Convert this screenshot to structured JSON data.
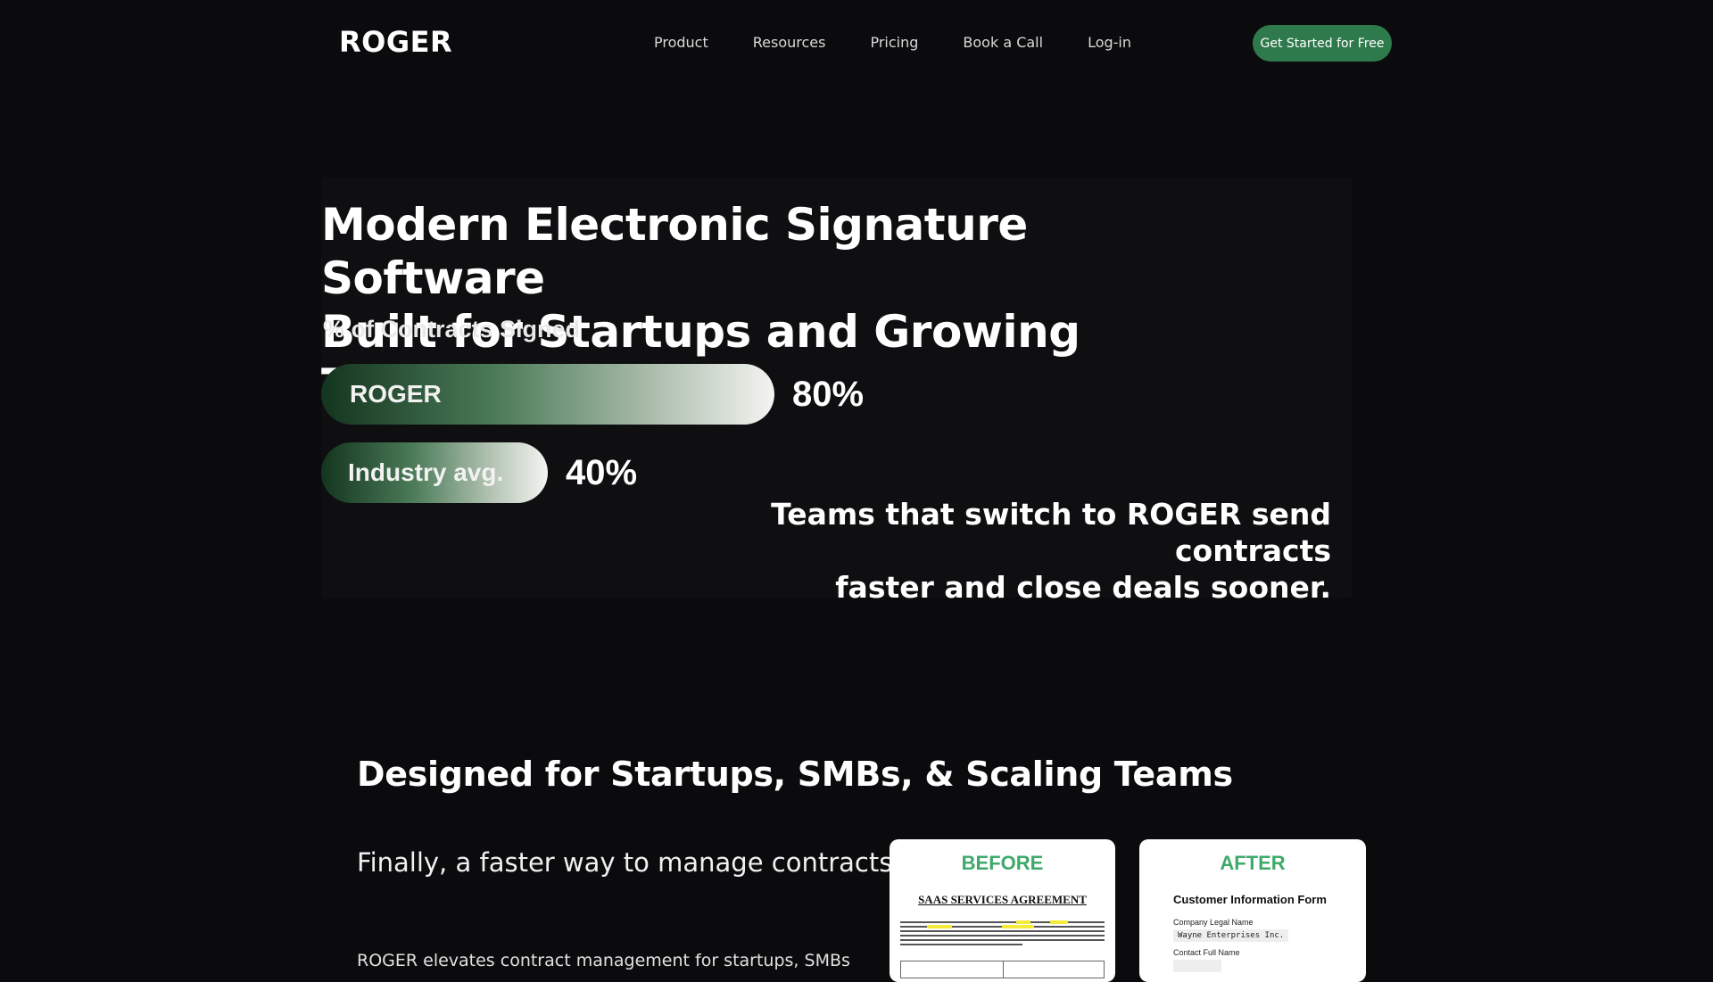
{
  "header": {
    "logo": "ROGER",
    "nav": [
      "Product",
      "Resources",
      "Pricing",
      "Book a Call",
      "Log-in"
    ],
    "cta_label": "Get Started for Free",
    "cta_color": "#2f7a4d"
  },
  "hero": {
    "title_line1": "Modern Electronic Signature Software",
    "title_line2": "Built for Startups and Growing Teams",
    "chart_label": "% of Contracts Signed",
    "tagline_line1": "Teams that switch to ROGER send contracts",
    "tagline_line2": "faster and close deals sooner."
  },
  "chart_data": {
    "type": "bar",
    "title": "% of Contracts Signed",
    "categories": [
      "ROGER",
      "Industry avg."
    ],
    "values": [
      80,
      40
    ],
    "value_labels": [
      "80%",
      "40%"
    ],
    "orientation": "horizontal",
    "xlim": [
      0,
      100
    ],
    "grid": false,
    "colors": [
      "#14351f",
      "#f4f4f2"
    ]
  },
  "section": {
    "title": "Designed for Startups, SMBs, & Scaling Teams",
    "subtitle": "Finally, a faster way to manage contracts.",
    "body": "ROGER elevates contract management for startups, SMBs &"
  },
  "cards": {
    "before": {
      "heading": "BEFORE",
      "doc_title": "SAAS SERVICES AGREEMENT"
    },
    "after": {
      "heading": "AFTER",
      "form_title": "Customer Information Form",
      "field1_label": "Company Legal Name",
      "field1_value": "Wayne Enterprises Inc.",
      "field2_label": "Contact Full Name"
    },
    "accent_color": "#3daa6a"
  }
}
